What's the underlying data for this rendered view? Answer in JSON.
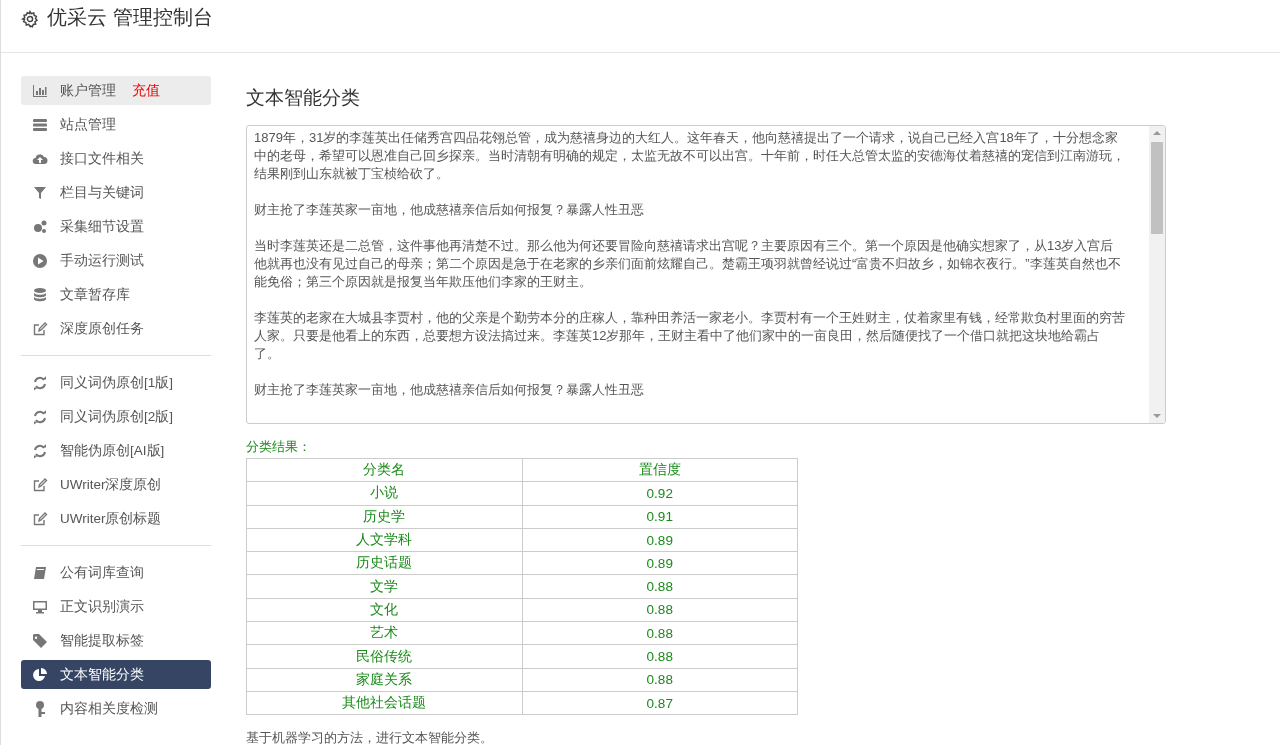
{
  "header": {
    "title": "优采云 管理控制台"
  },
  "sidebar": {
    "groups": [
      [
        {
          "label": "账户管理",
          "badge": "充值",
          "selected": false,
          "hovered": true
        },
        {
          "label": "站点管理",
          "selected": false,
          "hovered": false
        },
        {
          "label": "接口文件相关",
          "selected": false,
          "hovered": false
        },
        {
          "label": "栏目与关键词",
          "selected": false,
          "hovered": false
        },
        {
          "label": "采集细节设置",
          "selected": false,
          "hovered": false
        },
        {
          "label": "手动运行测试",
          "selected": false,
          "hovered": false
        },
        {
          "label": "文章暂存库",
          "selected": false,
          "hovered": false
        },
        {
          "label": "深度原创任务",
          "selected": false,
          "hovered": false
        }
      ],
      [
        {
          "label": "同义词伪原创[1版]",
          "selected": false,
          "hovered": false
        },
        {
          "label": "同义词伪原创[2版]",
          "selected": false,
          "hovered": false
        },
        {
          "label": "智能伪原创[AI版]",
          "selected": false,
          "hovered": false
        },
        {
          "label": "UWriter深度原创",
          "selected": false,
          "hovered": false
        },
        {
          "label": "UWriter原创标题",
          "selected": false,
          "hovered": false
        }
      ],
      [
        {
          "label": "公有词库查询",
          "selected": false,
          "hovered": false
        },
        {
          "label": "正文识别演示",
          "selected": false,
          "hovered": false
        },
        {
          "label": "智能提取标签",
          "selected": false,
          "hovered": false
        },
        {
          "label": "文本智能分类",
          "selected": true,
          "hovered": false
        },
        {
          "label": "内容相关度检测",
          "selected": false,
          "hovered": false
        }
      ]
    ]
  },
  "main": {
    "heading": "文本智能分类",
    "text_area": {
      "paragraphs": [
        "1879年，31岁的李莲英出任储秀宫四品花翎总管，成为慈禧身边的大红人。这年春天，他向慈禧提出了一个请求，说自己已经入宫18年了，十分想念家中的老母，希望可以恩准自己回乡探亲。当时清朝有明确的规定，太监无故不可以出宫。十年前，时任大总管太监的安德海仗着慈禧的宠信到江南游玩，结果刚到山东就被丁宝桢给砍了。",
        "财主抢了李莲英家一亩地，他成慈禧亲信后如何报复？暴露人性丑恶",
        "当时李莲英还是二总管，这件事他再清楚不过。那么他为何还要冒险向慈禧请求出宫呢？主要原因有三个。第一个原因是他确实想家了，从13岁入宫后他就再也没有见过自己的母亲；第二个原因是急于在老家的乡亲们面前炫耀自己。楚霸王项羽就曾经说过“富贵不归故乡，如锦衣夜行。”李莲英自然也不能免俗；第三个原因就是报复当年欺压他们李家的王财主。",
        "李莲英的老家在大城县李贾村，他的父亲是个勤劳本分的庄稼人，靠种田养活一家老小。李贾村有一个王姓财主，仗着家里有钱，经常欺负村里面的穷苦人家。只要是他看上的东西，总要想方设法搞过来。李莲英12岁那年，王财主看中了他们家中的一亩良田，然后随便找了一个借口就把这块地给霸占了。",
        "财主抢了李莲英家一亩地，他成慈禧亲信后如何报复？暴露人性丑恶"
      ]
    },
    "result_label": "分类结果：",
    "table": {
      "columns": [
        "分类名",
        "置信度"
      ],
      "rows": [
        [
          "小说",
          "0.92"
        ],
        [
          "历史学",
          "0.91"
        ],
        [
          "人文学科",
          "0.89"
        ],
        [
          "历史话题",
          "0.89"
        ],
        [
          "文学",
          "0.88"
        ],
        [
          "文化",
          "0.88"
        ],
        [
          "艺术",
          "0.88"
        ],
        [
          "民俗传统",
          "0.88"
        ],
        [
          "家庭关系",
          "0.88"
        ],
        [
          "其他社会话题",
          "0.87"
        ]
      ]
    },
    "footnote": "基于机器学习的方法，进行文本智能分类。"
  }
}
